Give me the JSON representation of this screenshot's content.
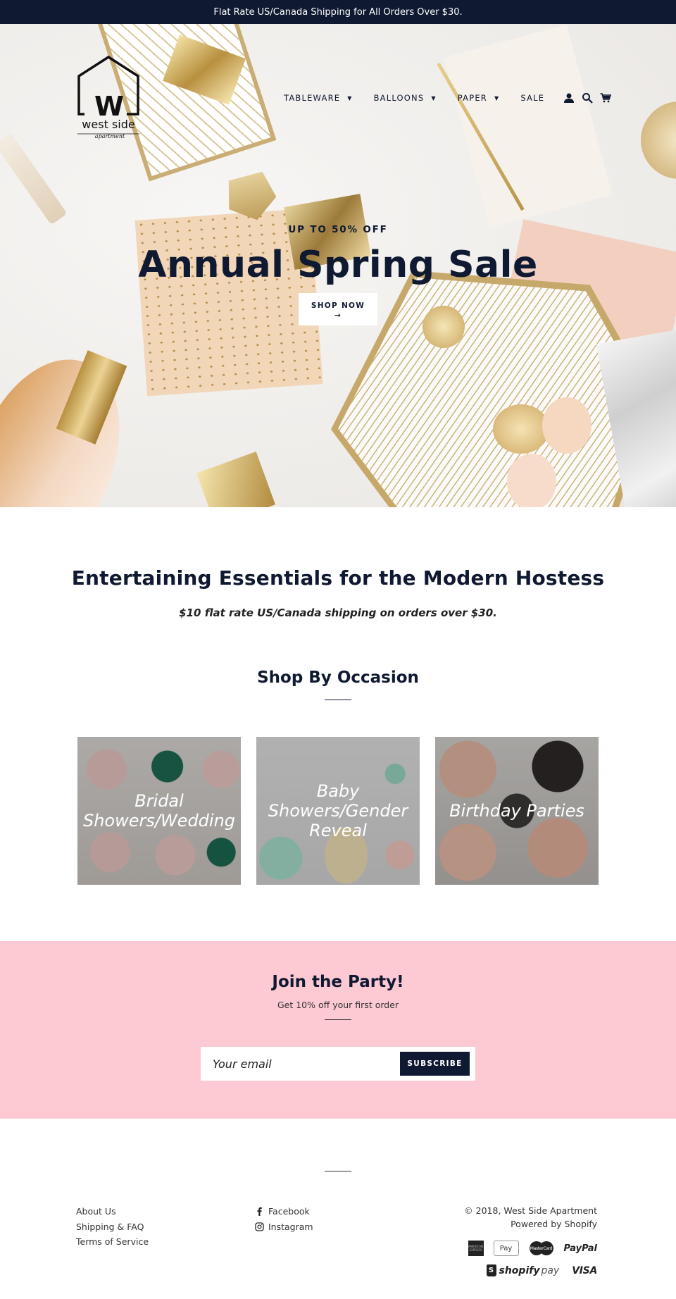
{
  "announcement": "Flat Rate US/Canada Shipping for All Orders Over $30.",
  "brand": {
    "name": "west side",
    "tagline": "apartment",
    "logo_letter": "W"
  },
  "nav": {
    "items": [
      {
        "label": "TABLEWARE",
        "has_dropdown": true
      },
      {
        "label": "BALLOONS",
        "has_dropdown": true
      },
      {
        "label": "PAPER",
        "has_dropdown": true
      },
      {
        "label": "SALE",
        "has_dropdown": false
      }
    ],
    "caret": "▼",
    "icons": [
      "account-icon",
      "search-icon",
      "cart-icon"
    ]
  },
  "hero": {
    "subtitle": "UP TO 50% OFF",
    "title": "Annual Spring Sale",
    "button_label": "SHOP NOW",
    "button_arrow": "→",
    "slides_total": 2,
    "active_slide": 1
  },
  "intro": {
    "title": "Entertaining Essentials for the Modern Hostess",
    "subtitle": "$10 flat rate US/Canada shipping on orders over $30."
  },
  "occasions": {
    "title": "Shop By Occasion",
    "tiles": [
      {
        "label": "Bridal Showers/Wedding"
      },
      {
        "label": "Baby Showers/Gender Reveal"
      },
      {
        "label": "Birthday Parties"
      }
    ]
  },
  "newsletter": {
    "title": "Join the Party!",
    "subtitle": "Get 10% off your first order",
    "email_placeholder": "Your email",
    "email_value": "",
    "button_label": "SUBSCRIBE",
    "background": "#fdc9d3"
  },
  "footer": {
    "links": [
      "About Us",
      "Shipping & FAQ",
      "Terms of Service"
    ],
    "social": [
      {
        "label": "Facebook",
        "icon": "facebook-icon"
      },
      {
        "label": "Instagram",
        "icon": "instagram-icon"
      }
    ],
    "copyright": "© 2018, West Side Apartment",
    "powered_by": "Powered by Shopify",
    "payments": {
      "amex": "AMERICAN EXPRESS",
      "apple_pay": " Pay",
      "mastercard": "MasterCard",
      "paypal": "PayPal",
      "shopify_pay_bold": "shopify",
      "shopify_pay_light": "pay",
      "visa": "VISA"
    }
  },
  "colors": {
    "navy": "#0f1931",
    "pink": "#fdc9d3",
    "white": "#ffffff"
  }
}
